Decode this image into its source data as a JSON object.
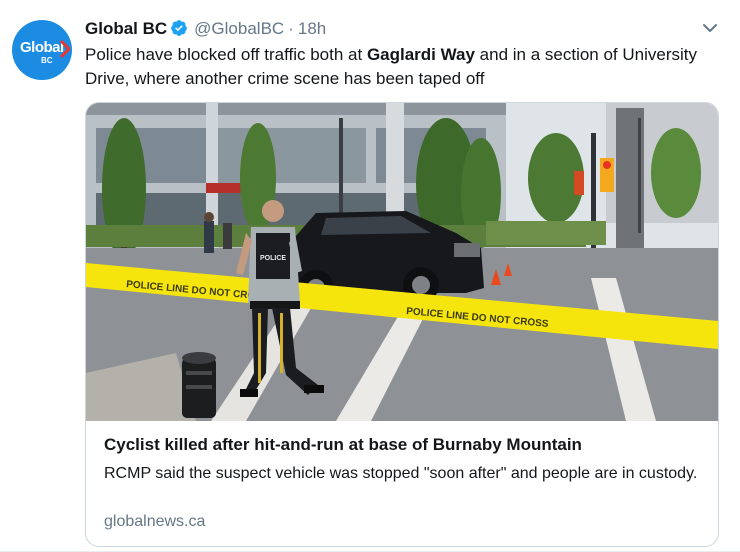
{
  "tweet": {
    "name": "Global BC",
    "handle": "@GlobalBC",
    "separator": "·",
    "time": "18h",
    "text_part1": "Police have blocked off traffic both at ",
    "text_bold": "Gaglardi Way",
    "text_part2": " and in a section of University Drive, where another crime scene has been taped off",
    "avatar_logo": "Global",
    "avatar_sub": "BC"
  },
  "card": {
    "title": "Cyclist killed after hit-and-run at base of Burnaby Mountain",
    "description": "RCMP said the suspect vehicle was stopped \"soon after\" and people are in custody.",
    "domain": "globalnews.ca",
    "tape_text": "POLICE LINE DO NOT CROSS",
    "sign_text": "POLICE"
  },
  "colors": {
    "brand": "#1c8ce3",
    "verified": "#1da1f2",
    "tape": "#f5e50d"
  }
}
